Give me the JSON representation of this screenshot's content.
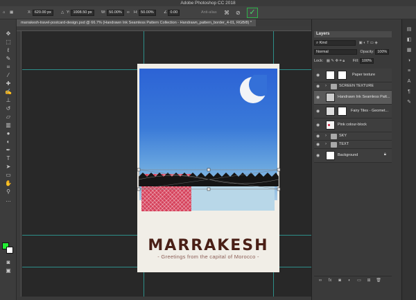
{
  "app": {
    "title": "Adobe Photoshop CC 2018"
  },
  "options_bar": {
    "x_label": "X:",
    "x_value": "620.00 px",
    "y_label": "Y:",
    "y_value": "1008.50 px",
    "w_label": "W:",
    "w_value": "50.00%",
    "h_label": "H:",
    "h_value": "50.00%",
    "angle_value": "0.00",
    "anti_alias_label": "Anti-alias",
    "commit_icon": "checkmark-icon",
    "cancel_icon": "cancel-icon",
    "warp_icon": "warp-icon"
  },
  "document": {
    "tab_title": "marrakesh-travel-postcard-design.psd @ 66.7% (Handrawn Ink Seamless Pattern Collection - Handrawn_pattern_border_4-01, RGB/8) *"
  },
  "poster": {
    "title": "MARRAKESH",
    "subtitle": "- Greetings from the capital of Morocco -",
    "colors": {
      "sky": "#3a7ad8",
      "title": "#4a1f16",
      "pattern": "#d6415b",
      "paper": "#f1eee7"
    }
  },
  "colors": {
    "foreground": "#22ee33",
    "background": "#ffffff",
    "accent_commit": "#2fb24a"
  },
  "layers_panel": {
    "title": "Layers",
    "kind_label": "Kind",
    "blend_mode": "Normal",
    "opacity_label": "Opacity:",
    "opacity_value": "100%",
    "lock_label": "Lock:",
    "fill_label": "Fill:",
    "fill_value": "100%",
    "layers": [
      {
        "name": "Paper texture",
        "type": "layer"
      },
      {
        "name": "SCREEN TEXTURE",
        "type": "group"
      },
      {
        "name": "Handrawn Ink Seamless Patt...",
        "type": "smart",
        "selected": true
      },
      {
        "name": "Fairy Tiles - Geomet...",
        "type": "layer"
      },
      {
        "name": "Pink colour-block",
        "type": "layer"
      },
      {
        "name": "SKY",
        "type": "group"
      },
      {
        "name": "TEXT",
        "type": "group"
      },
      {
        "name": "Background",
        "type": "background"
      }
    ]
  },
  "toolbar": {
    "tools": [
      "move-tool-icon",
      "marquee-icon",
      "lasso-icon",
      "quick-select-icon",
      "crop-icon",
      "eyedropper-icon",
      "healing-icon",
      "brush-icon",
      "stamp-icon",
      "history-brush-icon",
      "eraser-icon",
      "gradient-icon",
      "blur-icon",
      "dodge-icon",
      "pen-icon",
      "type-icon",
      "path-select-icon",
      "shape-icon",
      "hand-icon",
      "zoom-icon"
    ]
  }
}
